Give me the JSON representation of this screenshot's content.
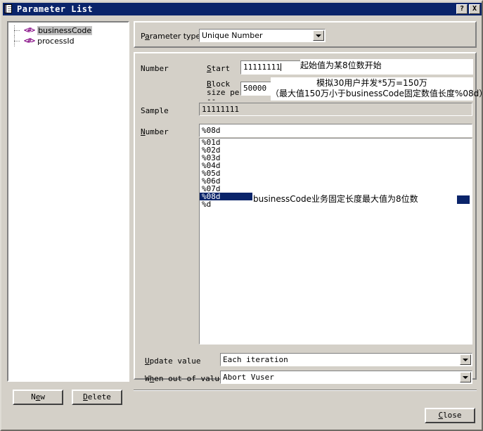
{
  "window": {
    "title": "Parameter List",
    "icon": "parameter-list-icon",
    "help_button": "?",
    "close_button": "X"
  },
  "tree": {
    "items": [
      {
        "icon": "<#>",
        "label": "businessCode",
        "selected": true
      },
      {
        "icon": "<#>",
        "label": "processId",
        "selected": false
      }
    ]
  },
  "buttons": {
    "new": {
      "before": "N",
      "mnemonic": "e",
      "after": "w"
    },
    "delete": {
      "before": "",
      "mnemonic": "D",
      "after": "elete"
    },
    "close": {
      "before": "",
      "mnemonic": "C",
      "after": "lose"
    }
  },
  "parameter_type": {
    "label_before": "P",
    "label_mnemonic": "a",
    "label_after": "rameter type:",
    "value": "Unique Number",
    "arrow_icon": "chevron-down-icon"
  },
  "number_group": {
    "section_label": "Number",
    "start": {
      "label_mnemonic": "S",
      "label_after": "tart",
      "value": "11111111",
      "note": "起始值为某8位数开始"
    },
    "block": {
      "label_mnemonic": "B",
      "label_line1_after": "lock",
      "label_line2": "size per",
      "label_line3": "--",
      "value": "50000",
      "note_line1": "模拟30用户并发*5万=150万",
      "note_line2": "（最大值150万小于businessCode固定数值长度%08d）"
    },
    "sample": {
      "label": "Sample",
      "value": "11111111"
    },
    "number_format": {
      "label_mnemonic": "N",
      "label_after": "umber",
      "value": "%08d"
    },
    "format_list": {
      "items": [
        "%01d",
        "%02d",
        "%03d",
        "%04d",
        "%05d",
        "%06d",
        "%07d",
        "%08d",
        "%d"
      ],
      "selected": "%08d",
      "note": "businessCode业务固定长度最大值为8位数"
    },
    "update_value": {
      "label_mnemonic": "U",
      "label_after": "pdate value",
      "value": "Each iteration",
      "arrow_icon": "chevron-down-icon"
    },
    "when_out_of_values": {
      "label_before": "W",
      "label_mnemonic": "h",
      "label_after": "en out of values",
      "value": "Abort Vuser",
      "arrow_icon": "chevron-down-icon"
    }
  }
}
